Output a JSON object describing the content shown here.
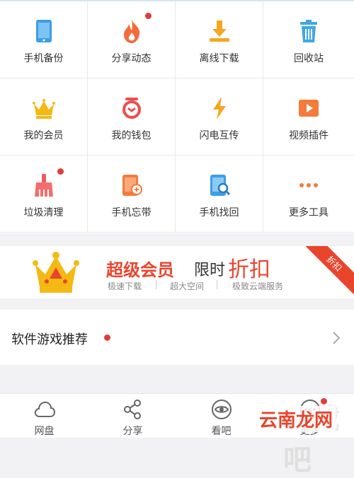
{
  "grid": {
    "items": [
      {
        "label": "手机备份",
        "icon": "phone-backup-icon"
      },
      {
        "label": "分享动态",
        "icon": "flame-icon",
        "badge": true
      },
      {
        "label": "离线下载",
        "icon": "download-icon"
      },
      {
        "label": "回收站",
        "icon": "trash-icon"
      },
      {
        "label": "我的会员",
        "icon": "crown-icon"
      },
      {
        "label": "我的钱包",
        "icon": "wallet-icon"
      },
      {
        "label": "闪电互传",
        "icon": "lightning-icon"
      },
      {
        "label": "视频插件",
        "icon": "video-play-icon"
      },
      {
        "label": "垃圾清理",
        "icon": "broom-icon",
        "badge": true
      },
      {
        "label": "手机忘带",
        "icon": "phone-forget-icon"
      },
      {
        "label": "手机找回",
        "icon": "phone-search-icon"
      },
      {
        "label": "更多工具",
        "icon": "more-dots-icon"
      }
    ]
  },
  "banner": {
    "title": "超级会员",
    "limited": "限时",
    "discount": "折扣",
    "corner_tag": "折扣",
    "features": [
      "极速下载",
      "超大空间",
      "极致云端服务"
    ],
    "colors": {
      "title": "#e8452c",
      "crown": "#f5b914"
    }
  },
  "recommend": {
    "label": "软件游戏推荐",
    "badge": true
  },
  "tabbar": {
    "tabs": [
      {
        "label": "网盘",
        "icon": "cloud-icon"
      },
      {
        "label": "分享",
        "icon": "share-icon"
      },
      {
        "label": "看吧",
        "icon": "eye-icon"
      },
      {
        "label": "更多",
        "icon": "more-icon",
        "badge": true
      }
    ]
  },
  "watermark": {
    "text": "云南龙网",
    "faded": "下载吧"
  }
}
